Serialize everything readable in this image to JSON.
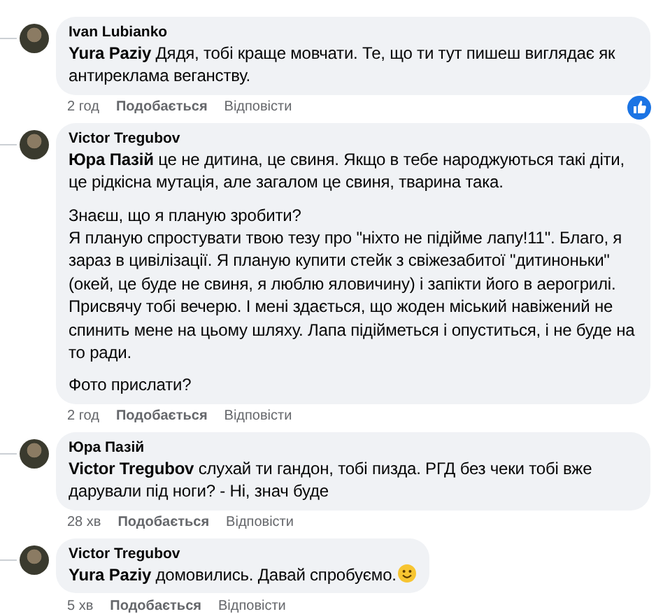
{
  "comments": [
    {
      "author": "Ivan Lubianko",
      "paragraphs": [
        "**Yura Paziy** Дядя, тобі краще мовчати. Те, що ти тут пишеш виглядає як антиреклама веганству."
      ],
      "time": "2 год",
      "like": "Подобається",
      "reply": "Відповісти",
      "reacted": true,
      "smiley": false
    },
    {
      "author": "Victor Tregubov",
      "paragraphs": [
        "**Юра Пазій** це не дитина, це свиня. Якщо в тебе народжуються такі діти, це рідкісна мутація, але загалом це свиня, тварина така.",
        "Знаєш, що я планую зробити?\nЯ планую спростувати твою тезу про \"ніхто не підійме лапу!11\". Благо, я зараз в цивілізації. Я планую купити стейк з свіжезабитої \"дитиноньки\" (окей, це буде не свиня, я люблю яловичину) і запікти його в аерогрилі. Присвячу тобі вечерю. І мені здається, що жоден міський навіжений не спинить мене на цьому шляху. Лапа підійметься і опуститься, і не буде на то ради.",
        "Фото прислати?"
      ],
      "time": "2 год",
      "like": "Подобається",
      "reply": "Відповісти",
      "reacted": false,
      "smiley": false
    },
    {
      "author": "Юра Пазій",
      "paragraphs": [
        "**Victor Tregubov** слухай ти гандон, тобі пизда. РГД без чеки тобі вже дарували під ноги? - Ні, знач буде"
      ],
      "time": "28 хв",
      "like": "Подобається",
      "reply": "Відповісти",
      "reacted": false,
      "smiley": false
    },
    {
      "author": "Victor Tregubov",
      "paragraphs": [
        "**Yura Paziy** домовились. Давай спробуємо."
      ],
      "time": "5 хв",
      "like": "Подобається",
      "reply": "Відповісти",
      "reacted": false,
      "smiley": true
    }
  ]
}
